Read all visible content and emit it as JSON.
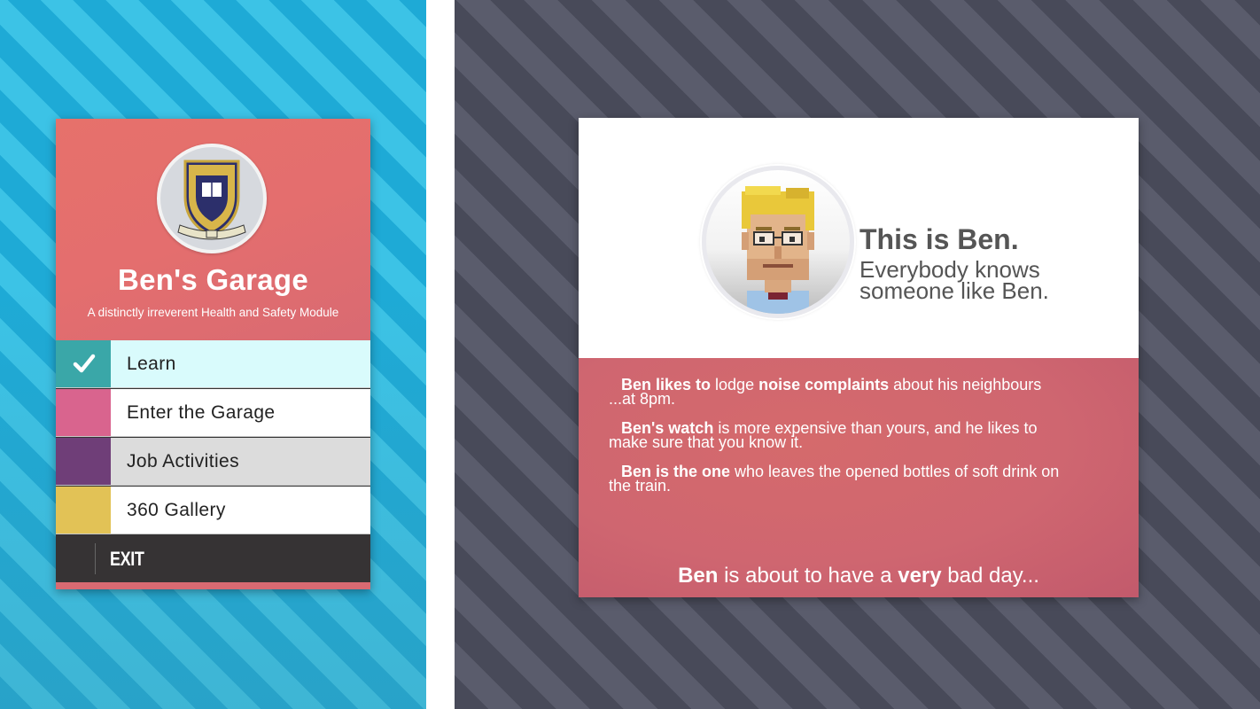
{
  "app": {
    "title": "Ben's Garage",
    "subtitle": "A distinctly irreverent Health and Safety Module",
    "logo_icon": "university-crest-icon"
  },
  "menu": {
    "items": [
      {
        "label": "Learn",
        "color": "#3aa7a8",
        "completed": true,
        "icon": "checkmark-icon"
      },
      {
        "label": "Enter the Garage",
        "color": "#d9648e",
        "completed": false
      },
      {
        "label": "Job Activities",
        "color": "#6f3e78",
        "completed": false
      },
      {
        "label": "360 Gallery",
        "color": "#e2c256",
        "completed": false
      }
    ],
    "exit_label": "EXIT"
  },
  "intro": {
    "avatar_icon": "ben-character-avatar",
    "heading": "This is Ben.",
    "subheading_line1": "Everybody knows",
    "subheading_line2": "someone like Ben.",
    "facts": [
      {
        "bold_1": "Ben likes to",
        "text_1": " lodge ",
        "bold_2": "noise complaints",
        "text_2": " about his neighbours ...at 8pm."
      },
      {
        "bold_1": "Ben's watch",
        "text_1": " is more expensive than yours, and he likes to make sure that you know it.",
        "bold_2": "",
        "text_2": ""
      },
      {
        "bold_1": "Ben is the one",
        "text_1": " who leaves the opened bottles of soft drink on the train.",
        "bold_2": "",
        "text_2": ""
      }
    ],
    "closing": {
      "bold_1": "Ben",
      "text_1": " is about to have a ",
      "bold_2": "very",
      "text_2": " bad day..."
    }
  },
  "colors": {
    "left_bg": "#1eaad6",
    "right_bg": "#484a59",
    "header": "#e46e6e",
    "exit_bar": "#363334"
  }
}
